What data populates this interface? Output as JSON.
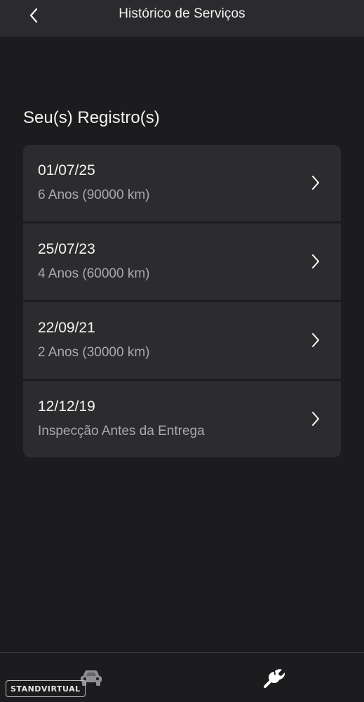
{
  "header": {
    "title": "Histórico de Serviços",
    "back_icon": "chevron-left-icon"
  },
  "section": {
    "title": "Seu(s) Registro(s)"
  },
  "records": [
    {
      "date": "01/07/25",
      "description": "6 Anos (90000 km)"
    },
    {
      "date": "25/07/23",
      "description": "4 Anos (60000 km)"
    },
    {
      "date": "22/09/21",
      "description": "2 Anos (30000 km)"
    },
    {
      "date": "12/12/19",
      "description": "Inspecção Antes da Entrega"
    }
  ],
  "bottom_nav": {
    "tabs": [
      {
        "icon": "car-icon"
      },
      {
        "icon": "wrench-icon"
      }
    ]
  },
  "watermark": "STANDVIRTUAL",
  "colors": {
    "background": "#1c1c1e",
    "header": "#2b2b2e",
    "card": "#2c2c2e",
    "text_primary": "#f4f4f4",
    "text_secondary": "#a9a9ad"
  }
}
